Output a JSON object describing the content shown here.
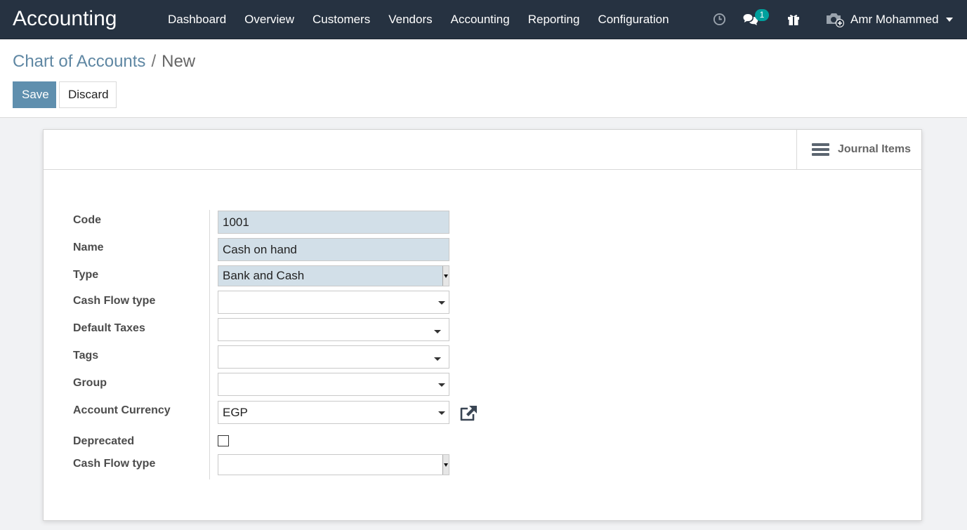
{
  "app": {
    "title": "Accounting"
  },
  "menu": [
    "Dashboard",
    "Overview",
    "Customers",
    "Vendors",
    "Accounting",
    "Reporting",
    "Configuration"
  ],
  "systray": {
    "activity_icon": "clock-icon",
    "messages_icon": "chat-icon",
    "messages_count": "1",
    "gift_icon": "gift-icon",
    "avatar_icon": "camera-plus-icon",
    "user_name": "Amr Mohammed"
  },
  "breadcrumb": {
    "parent": "Chart of Accounts",
    "separator": "/",
    "current": "New"
  },
  "buttons": {
    "save": "Save",
    "discard": "Discard"
  },
  "smart_button": {
    "label": "Journal Items",
    "icon": "bars-icon"
  },
  "form": {
    "code": {
      "label": "Code",
      "value": "1001"
    },
    "name": {
      "label": "Name",
      "value": "Cash on hand"
    },
    "type": {
      "label": "Type",
      "value": "Bank and Cash"
    },
    "cash_flow_type": {
      "label": "Cash Flow type",
      "value": ""
    },
    "default_taxes": {
      "label": "Default Taxes",
      "value": ""
    },
    "tags": {
      "label": "Tags",
      "value": ""
    },
    "group": {
      "label": "Group",
      "value": ""
    },
    "account_currency": {
      "label": "Account Currency",
      "value": "EGP"
    },
    "deprecated": {
      "label": "Deprecated",
      "checked": false
    },
    "cash_flow_type_2": {
      "label": "Cash Flow type",
      "value": ""
    }
  },
  "colors": {
    "navbar": "#263241",
    "primary": "#5f8fae",
    "required_field": "#d2dfe8",
    "badge": "#00a09d"
  }
}
